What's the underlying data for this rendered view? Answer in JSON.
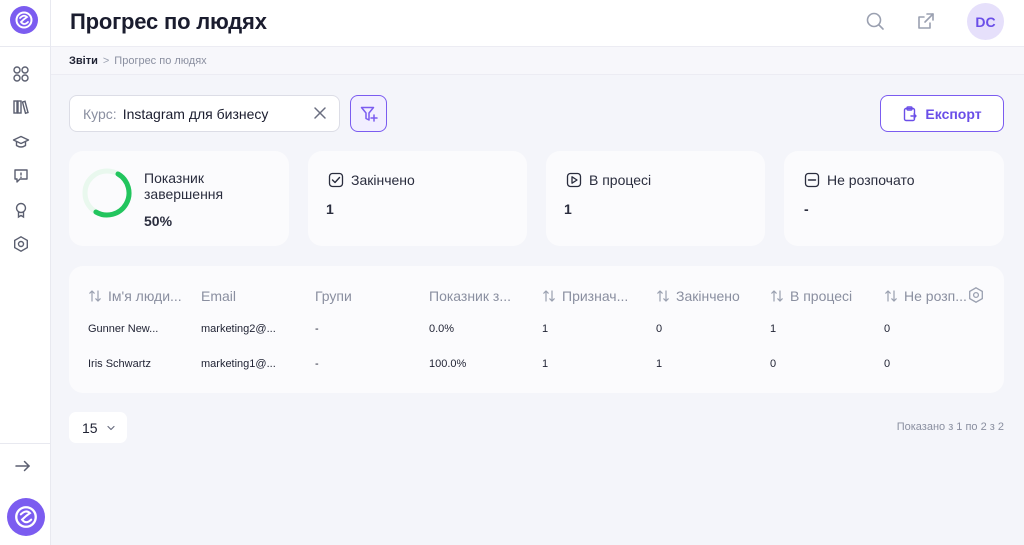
{
  "header": {
    "title": "Прогрес по людях",
    "avatar_initials": "DC"
  },
  "breadcrumb": {
    "root": "Звіти",
    "separator": ">",
    "current": "Прогрес по людях"
  },
  "sidebar": {
    "items": [
      {
        "icon": "grid-icon"
      },
      {
        "icon": "library-icon"
      },
      {
        "icon": "graduation-cap-icon"
      },
      {
        "icon": "feedback-icon"
      },
      {
        "icon": "award-icon"
      },
      {
        "icon": "settings-hexagon-icon"
      }
    ],
    "expand_icon": "arrow-right-icon"
  },
  "filters": {
    "course_label": "Курс:",
    "course_value": "Instagram для бизнесу",
    "export_label": "Експорт"
  },
  "stats": {
    "completion": {
      "title": "Показник завершення",
      "value": "50%",
      "fraction": 0.5
    },
    "finished": {
      "title": "Закінчено",
      "value": "1"
    },
    "in_progress": {
      "title": "В процесі",
      "value": "1"
    },
    "not_started": {
      "title": "Не розпочато",
      "value": "-"
    }
  },
  "table": {
    "columns": [
      "Ім'я люди...",
      "Email",
      "Групи",
      "Показник з...",
      "Признач...",
      "Закінчено",
      "В процесі",
      "Не розп..."
    ],
    "rows": [
      [
        "Gunner New...",
        "marketing2@...",
        "-",
        "0.0%",
        "1",
        "0",
        "1",
        "0"
      ],
      [
        "Iris Schwartz",
        "marketing1@...",
        "-",
        "100.0%",
        "1",
        "1",
        "0",
        "0"
      ]
    ]
  },
  "pagination": {
    "page_size": "15",
    "info": "Показано з 1 по 2 з 2"
  },
  "colors": {
    "accent": "#7b5cf0",
    "progress": "#22c55e",
    "background": "#f4f5fa"
  }
}
